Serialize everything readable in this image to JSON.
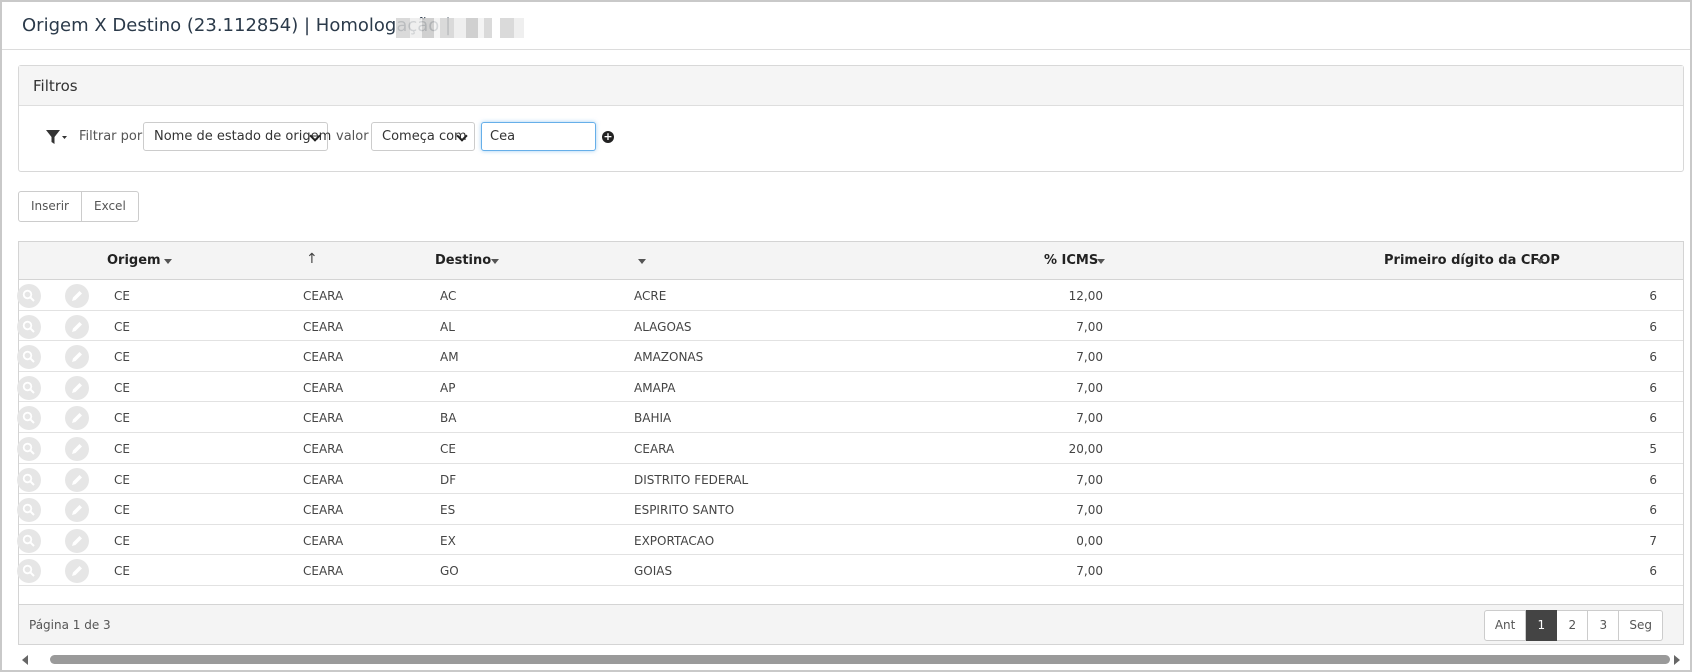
{
  "header": {
    "title": "Origem X Destino (23.112854) | Homologação |"
  },
  "filters": {
    "panel_title": "Filtros",
    "filter_by_label": "Filtrar por",
    "field_select": "Nome de estado de origem",
    "value_label": "valor",
    "operator_select": "Começa com",
    "value_input": "Cea"
  },
  "toolbar": {
    "insert_label": "Inserir",
    "excel_label": "Excel"
  },
  "grid": {
    "columns": {
      "origem": "Origem",
      "destino": "Destino",
      "icms": "% ICMS",
      "cfop": "Primeiro dígito da CFOP"
    },
    "rows": [
      {
        "uf_origem": "CE",
        "nome_origem": "CEARA",
        "uf_destino": "AC",
        "nome_destino": "ACRE",
        "icms": "12,00",
        "cfop": "6"
      },
      {
        "uf_origem": "CE",
        "nome_origem": "CEARA",
        "uf_destino": "AL",
        "nome_destino": "ALAGOAS",
        "icms": "7,00",
        "cfop": "6"
      },
      {
        "uf_origem": "CE",
        "nome_origem": "CEARA",
        "uf_destino": "AM",
        "nome_destino": "AMAZONAS",
        "icms": "7,00",
        "cfop": "6"
      },
      {
        "uf_origem": "CE",
        "nome_origem": "CEARA",
        "uf_destino": "AP",
        "nome_destino": "AMAPA",
        "icms": "7,00",
        "cfop": "6"
      },
      {
        "uf_origem": "CE",
        "nome_origem": "CEARA",
        "uf_destino": "BA",
        "nome_destino": "BAHIA",
        "icms": "7,00",
        "cfop": "6"
      },
      {
        "uf_origem": "CE",
        "nome_origem": "CEARA",
        "uf_destino": "CE",
        "nome_destino": "CEARA",
        "icms": "20,00",
        "cfop": "5"
      },
      {
        "uf_origem": "CE",
        "nome_origem": "CEARA",
        "uf_destino": "DF",
        "nome_destino": "DISTRITO FEDERAL",
        "icms": "7,00",
        "cfop": "6"
      },
      {
        "uf_origem": "CE",
        "nome_origem": "CEARA",
        "uf_destino": "ES",
        "nome_destino": "ESPIRITO SANTO",
        "icms": "7,00",
        "cfop": "6"
      },
      {
        "uf_origem": "CE",
        "nome_origem": "CEARA",
        "uf_destino": "EX",
        "nome_destino": "EXPORTACAO",
        "icms": "0,00",
        "cfop": "7"
      },
      {
        "uf_origem": "CE",
        "nome_origem": "CEARA",
        "uf_destino": "GO",
        "nome_destino": "GOIAS",
        "icms": "7,00",
        "cfop": "6"
      }
    ]
  },
  "footer": {
    "page_info": "Página 1 de 3",
    "prev_label": "Ant",
    "pages": [
      "1",
      "2",
      "3"
    ],
    "next_label": "Seg",
    "current_page": "1"
  },
  "icons": {
    "filter": "funnel-icon",
    "add": "plus-circle-icon",
    "view": "magnifier-icon",
    "edit": "pencil-icon"
  }
}
